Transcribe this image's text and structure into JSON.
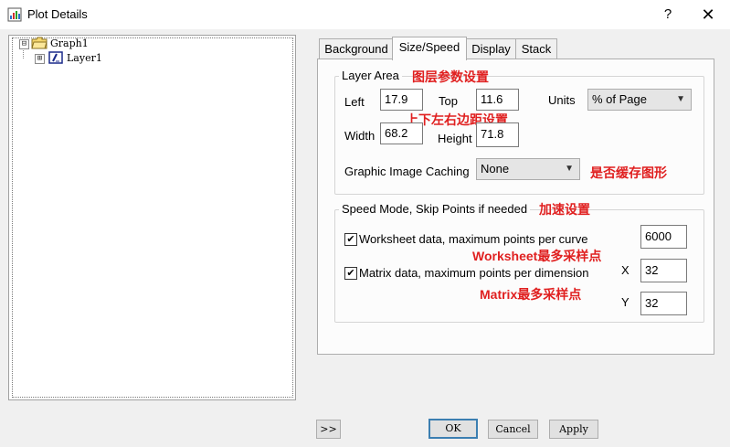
{
  "window": {
    "title": "Plot Details",
    "help": "?",
    "close": "✕"
  },
  "tree": {
    "root": "Graph1",
    "child": "Layer1",
    "root_expander": "⊟",
    "child_expander": "⊞"
  },
  "tabs": [
    "Background",
    "Size/Speed",
    "Display",
    "Stack"
  ],
  "layer_area": {
    "title": "Layer Area",
    "left_label": "Left",
    "left_value": "17.9",
    "top_label": "Top",
    "top_value": "11.6",
    "units_label": "Units",
    "units_value": "% of Page",
    "width_label": "Width",
    "width_value": "68.2",
    "height_label": "Height",
    "height_value": "71.8",
    "caching_label": "Graphic Image Caching",
    "caching_value": "None"
  },
  "speed_mode": {
    "title": "Speed Mode, Skip Points if needed",
    "worksheet_label": "Worksheet data, maximum points per curve",
    "worksheet_checked": true,
    "worksheet_value": "6000",
    "matrix_label": "Matrix data, maximum points per dimension",
    "matrix_checked": true,
    "x_label": "X",
    "x_value": "32",
    "y_label": "Y",
    "y_value": "32"
  },
  "annotations": {
    "layer_area": "图层参数设置",
    "margins": "上下左右边距设置",
    "caching": "是否缓存图形",
    "speed": "加速设置",
    "worksheet": "Worksheet最多采样点",
    "matrix": "Matrix最多采样点"
  },
  "buttons": {
    "more": ">>",
    "ok": "OK",
    "cancel": "Cancel",
    "apply": "Apply"
  },
  "colors": {
    "annotation": "#e02020",
    "default_button_border": "#3c7fb1"
  }
}
